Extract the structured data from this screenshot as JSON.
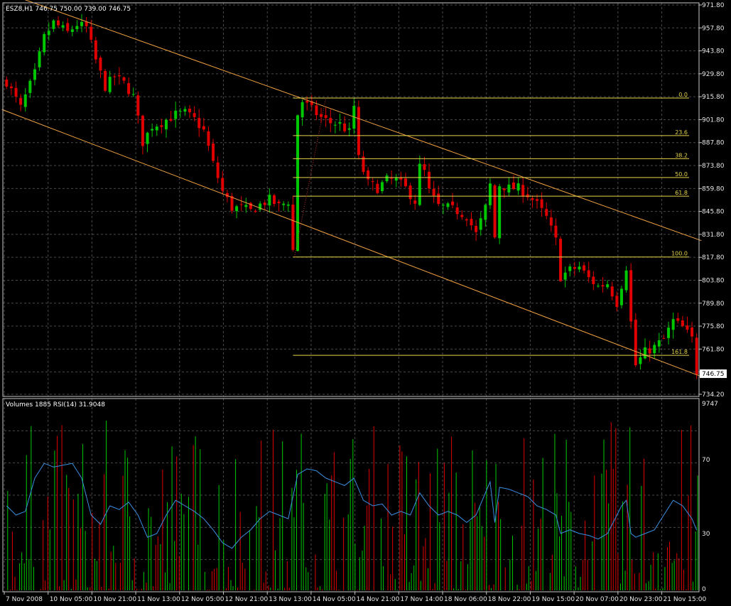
{
  "colors": {
    "background": "#000000",
    "grid": "#4a4a4a",
    "frame": "#c8c8c8",
    "bull": "#00c800",
    "bear": "#e00000",
    "channel": "#f0a040",
    "fibo": "#e6d34a",
    "rsi": "#3a8ee0",
    "text": "#e8e8e8"
  },
  "chart_data": [
    {
      "type": "candlestick",
      "header": "ESZ8,H1  746.75 750.00 739.00 746.75",
      "ylim": [
        734.2,
        971.8
      ],
      "y_ticks": [
        "971.80",
        "957.80",
        "943.80",
        "929.80",
        "915.80",
        "901.80",
        "887.80",
        "873.80",
        "859.80",
        "845.80",
        "831.80",
        "817.80",
        "803.80",
        "789.80",
        "775.80",
        "761.80",
        "747.80",
        "734.20"
      ],
      "current_price_label": "746.75",
      "current_price": 746.75,
      "x_tick_labels": [
        "7 Nov 2008",
        "10 Nov 05:00",
        "10 Nov 21:00",
        "11 Nov 13:00",
        "12 Nov 05:00",
        "12 Nov 21:00",
        "13 Nov 13:00",
        "14 Nov 05:00",
        "14 Nov 21:00",
        "17 Nov 14:00",
        "18 Nov 06:00",
        "18 Nov 22:00",
        "19 Nov 15:00",
        "20 Nov 07:00",
        "20 Nov 23:00",
        "21 Nov 15:00"
      ],
      "price_path": [
        [
          0,
          925
        ],
        [
          3,
          909
        ],
        [
          6,
          930
        ],
        [
          8,
          952
        ],
        [
          10,
          961
        ],
        [
          13,
          955
        ],
        [
          15,
          960
        ],
        [
          17,
          958
        ],
        [
          19,
          938
        ],
        [
          21,
          922
        ],
        [
          23,
          928
        ],
        [
          25,
          924
        ],
        [
          27,
          916
        ],
        [
          29,
          888
        ],
        [
          31,
          898
        ],
        [
          33,
          900
        ],
        [
          36,
          905
        ],
        [
          38,
          906
        ],
        [
          40,
          902
        ],
        [
          42,
          895
        ],
        [
          44,
          875
        ],
        [
          46,
          858
        ],
        [
          48,
          848
        ],
        [
          50,
          848
        ],
        [
          52,
          846
        ],
        [
          54,
          850
        ],
        [
          56,
          853
        ],
        [
          58,
          849
        ],
        [
          60,
          852
        ],
        [
          61,
          822
        ],
        [
          62,
          905
        ],
        [
          63,
          913
        ],
        [
          65,
          908
        ],
        [
          67,
          903
        ],
        [
          69,
          900
        ],
        [
          71,
          899
        ],
        [
          73,
          894
        ],
        [
          74,
          910
        ],
        [
          75,
          878
        ],
        [
          77,
          863
        ],
        [
          79,
          860
        ],
        [
          81,
          865
        ],
        [
          83,
          865
        ],
        [
          85,
          860
        ],
        [
          87,
          852
        ],
        [
          88,
          873
        ],
        [
          89,
          870
        ],
        [
          90,
          858
        ],
        [
          92,
          849
        ],
        [
          94,
          848
        ],
        [
          96,
          846
        ],
        [
          98,
          843
        ],
        [
          100,
          832
        ],
        [
          102,
          848
        ],
        [
          103,
          862
        ],
        [
          104,
          830
        ],
        [
          105,
          862
        ],
        [
          107,
          860
        ],
        [
          109,
          860
        ],
        [
          111,
          856
        ],
        [
          113,
          850
        ],
        [
          115,
          842
        ],
        [
          117,
          828
        ],
        [
          118,
          806
        ],
        [
          120,
          810
        ],
        [
          122,
          812
        ],
        [
          124,
          805
        ],
        [
          126,
          800
        ],
        [
          128,
          802
        ],
        [
          130,
          790
        ],
        [
          132,
          812
        ],
        [
          133,
          778
        ],
        [
          134,
          752
        ],
        [
          136,
          760
        ],
        [
          138,
          763
        ],
        [
          140,
          768
        ],
        [
          142,
          779
        ],
        [
          144,
          775
        ],
        [
          146,
          768
        ],
        [
          147,
          748
        ]
      ],
      "channel_upper": {
        "from": [
          -1,
          980
        ],
        "to": [
          148,
          828
        ]
      },
      "channel_lower": {
        "from": [
          -1,
          908
        ],
        "to": [
          148,
          745
        ]
      },
      "fibo": {
        "high": 915.0,
        "low": 818.0,
        "x_start": 61,
        "levels": [
          {
            "label": "0.0",
            "value": 915.0
          },
          {
            "label": "23.6",
            "value": 892.1
          },
          {
            "label": "38.2",
            "value": 878.0
          },
          {
            "label": "50.0",
            "value": 866.5
          },
          {
            "label": "61.8",
            "value": 855.1
          },
          {
            "label": "100.0",
            "value": 818.0
          },
          {
            "label": "161.8",
            "value": 758.0
          }
        ]
      }
    },
    {
      "type": "histogram+line",
      "header": "Volumes 1885  RSI(14) 31.9048",
      "ylim": [
        0,
        100
      ],
      "y_ticks": [
        "9747",
        "70",
        "30",
        "0"
      ],
      "rsi_path": [
        [
          0,
          45
        ],
        [
          2,
          40
        ],
        [
          4,
          42
        ],
        [
          6,
          60
        ],
        [
          8,
          68
        ],
        [
          10,
          66
        ],
        [
          12,
          67
        ],
        [
          14,
          68
        ],
        [
          16,
          60
        ],
        [
          18,
          40
        ],
        [
          20,
          35
        ],
        [
          22,
          45
        ],
        [
          24,
          43
        ],
        [
          26,
          47
        ],
        [
          28,
          40
        ],
        [
          30,
          28
        ],
        [
          32,
          30
        ],
        [
          34,
          40
        ],
        [
          36,
          48
        ],
        [
          38,
          45
        ],
        [
          40,
          42
        ],
        [
          42,
          38
        ],
        [
          44,
          32
        ],
        [
          46,
          25
        ],
        [
          48,
          22
        ],
        [
          50,
          28
        ],
        [
          52,
          32
        ],
        [
          54,
          38
        ],
        [
          56,
          42
        ],
        [
          58,
          40
        ],
        [
          60,
          38
        ],
        [
          62,
          62
        ],
        [
          64,
          65
        ],
        [
          66,
          64
        ],
        [
          68,
          60
        ],
        [
          70,
          58
        ],
        [
          72,
          56
        ],
        [
          74,
          60
        ],
        [
          76,
          48
        ],
        [
          78,
          45
        ],
        [
          80,
          46
        ],
        [
          82,
          40
        ],
        [
          84,
          42
        ],
        [
          86,
          40
        ],
        [
          88,
          52
        ],
        [
          90,
          45
        ],
        [
          92,
          40
        ],
        [
          94,
          42
        ],
        [
          96,
          40
        ],
        [
          98,
          36
        ],
        [
          100,
          40
        ],
        [
          102,
          52
        ],
        [
          103,
          58
        ],
        [
          104,
          36
        ],
        [
          105,
          55
        ],
        [
          107,
          54
        ],
        [
          109,
          52
        ],
        [
          111,
          50
        ],
        [
          113,
          45
        ],
        [
          115,
          43
        ],
        [
          117,
          40
        ],
        [
          118,
          30
        ],
        [
          120,
          32
        ],
        [
          122,
          30
        ],
        [
          124,
          29
        ],
        [
          126,
          27
        ],
        [
          128,
          30
        ],
        [
          130,
          40
        ],
        [
          131,
          45
        ],
        [
          132,
          48
        ],
        [
          133,
          30
        ],
        [
          134,
          28
        ],
        [
          136,
          30
        ],
        [
          138,
          32
        ],
        [
          140,
          40
        ],
        [
          142,
          48
        ],
        [
          144,
          45
        ],
        [
          146,
          38
        ],
        [
          147,
          31.9
        ]
      ],
      "volume_seed": 7
    }
  ]
}
